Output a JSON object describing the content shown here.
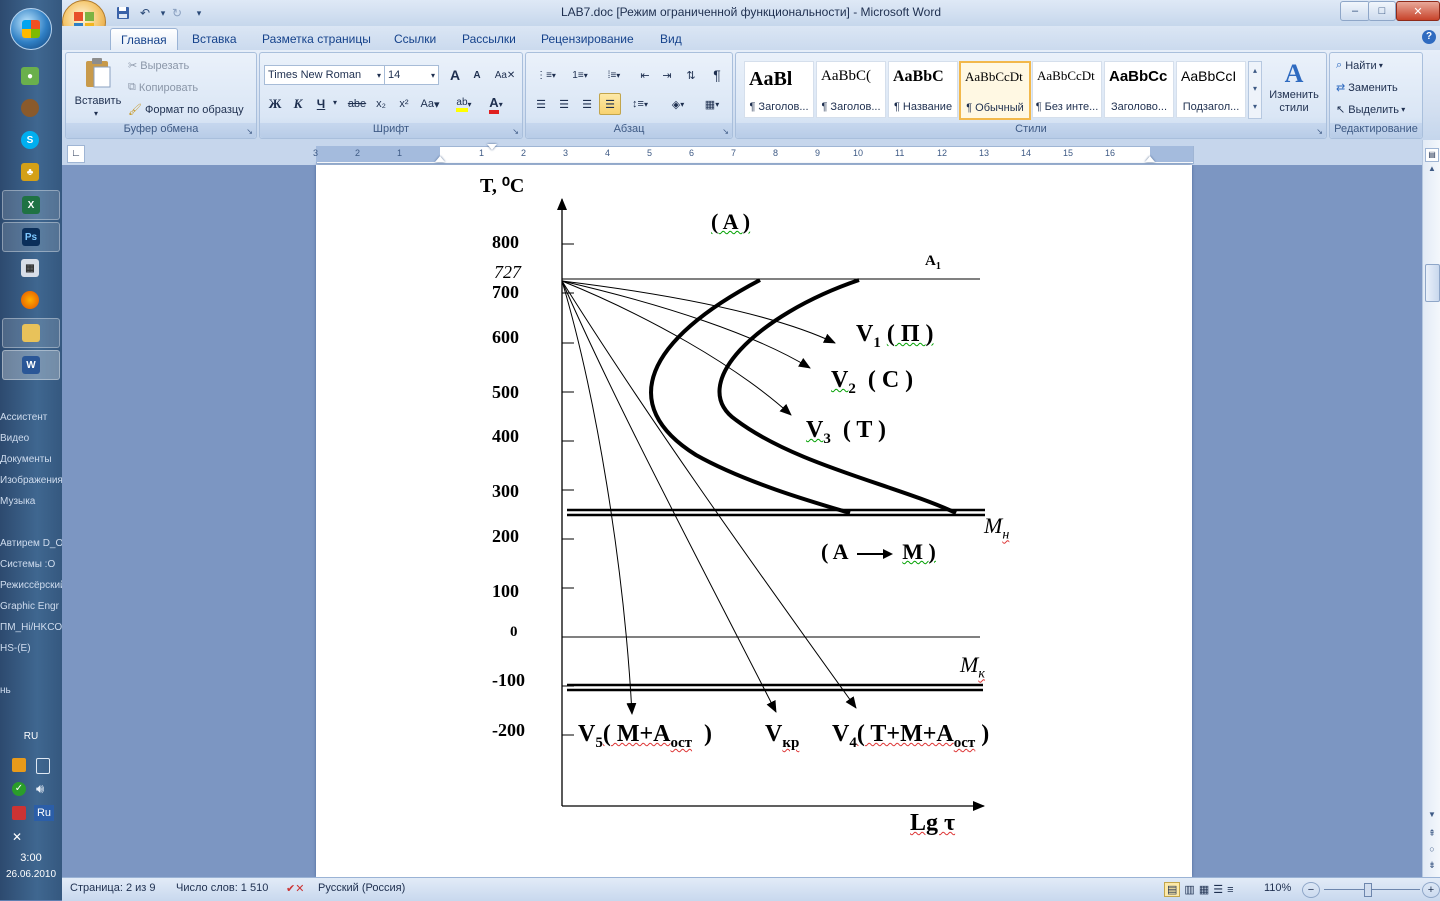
{
  "window": {
    "title": "LAB7.doc [Режим ограниченной функциональности] - Microsoft Word",
    "minimize": "–",
    "maximize": "□",
    "close": "✕"
  },
  "tabs": [
    "Главная",
    "Вставка",
    "Разметка страницы",
    "Ссылки",
    "Рассылки",
    "Рецензирование",
    "Вид"
  ],
  "clipboard": {
    "label": "Буфер обмена",
    "paste": "Вставить",
    "cut": "Вырезать",
    "copy": "Копировать",
    "format_painter": "Формат по образцу"
  },
  "font": {
    "label": "Шрифт",
    "family": "Times New Roman",
    "size": "14",
    "bold": "Ж",
    "italic": "К",
    "underline": "Ч",
    "strike": "abe",
    "subscript": "x₂",
    "superscript": "x²",
    "change_case": "Aa",
    "grow": "A",
    "shrink": "A"
  },
  "paragraph": {
    "label": "Абзац",
    "pilcrow": "¶"
  },
  "styles": {
    "label": "Стили",
    "items": [
      {
        "preview": "AaBl",
        "name": "¶ Заголов..."
      },
      {
        "preview": "AaBbC(",
        "name": "¶ Заголов..."
      },
      {
        "preview": "AaBbC",
        "name": "¶ Название"
      },
      {
        "preview": "AaBbCcDt",
        "name": "¶ Обычный"
      },
      {
        "preview": "AaBbCcDt",
        "name": "¶ Без инте..."
      },
      {
        "preview": "AaBbCc",
        "name": "Заголово..."
      },
      {
        "preview": "AaBbCcI",
        "name": "Подзагол..."
      }
    ],
    "change_styles": "Изменить стили"
  },
  "editing": {
    "label": "Редактирование",
    "find": "Найти",
    "replace": "Заменить",
    "select": "Выделить"
  },
  "ruler_numbers": [
    "3",
    "2",
    "1",
    "1",
    "2",
    "3",
    "4",
    "5",
    "6",
    "7",
    "8",
    "9",
    "10",
    "11",
    "12",
    "13",
    "14",
    "15",
    "16"
  ],
  "taskbar": {
    "texts": [
      "Ассистент",
      "Видео",
      "Документы",
      "Изображения",
      "Музыка",
      "Автирем D_O",
      "Системы :O",
      "Режиссёрский",
      "Graphic Engr",
      "ПМ_Hi/HKCO",
      "HS-(E)",
      "нь"
    ],
    "lang": "RU",
    "tray_lang": "Ru",
    "time": "3:00",
    "date": "26.06.2010"
  },
  "figure": {
    "y_axis_label": "T, ⁰C",
    "region_A": "( A )",
    "A1": "A",
    "A1_sub": "1",
    "ticks": [
      "800",
      "727",
      "700",
      "600",
      "500",
      "400",
      "300",
      "200",
      "100",
      "0",
      "-100",
      "-200"
    ],
    "Mn": "M",
    "Mn_sub": "н",
    "Mk": "M",
    "Mk_sub": "к",
    "a_to_m_a": "( A",
    "a_to_m_m": "M )",
    "v1": "V",
    "v1_sub": "1",
    "v1_text": "( П )",
    "v2": "V",
    "v2_sub": "2",
    "v2_text": "( C )",
    "v3": "V",
    "v3_sub": "3",
    "v3_text": "( T )",
    "v5": "V",
    "v5_sub": "5",
    "v5_text": "( M+A",
    "v5_sub2": "ост",
    "v5_close": ")",
    "vkr": "V",
    "vkr_sub": "кр",
    "v4": "V",
    "v4_sub": "4",
    "v4_text": "( T+M+A",
    "v4_sub2": "ост",
    "v4_close": ")",
    "x_axis_label": "Lg τ"
  },
  "status": {
    "page": "Страница: 2 из 9",
    "words": "Число слов: 1 510",
    "language": "Русский (Россия)",
    "zoom": "110%"
  }
}
